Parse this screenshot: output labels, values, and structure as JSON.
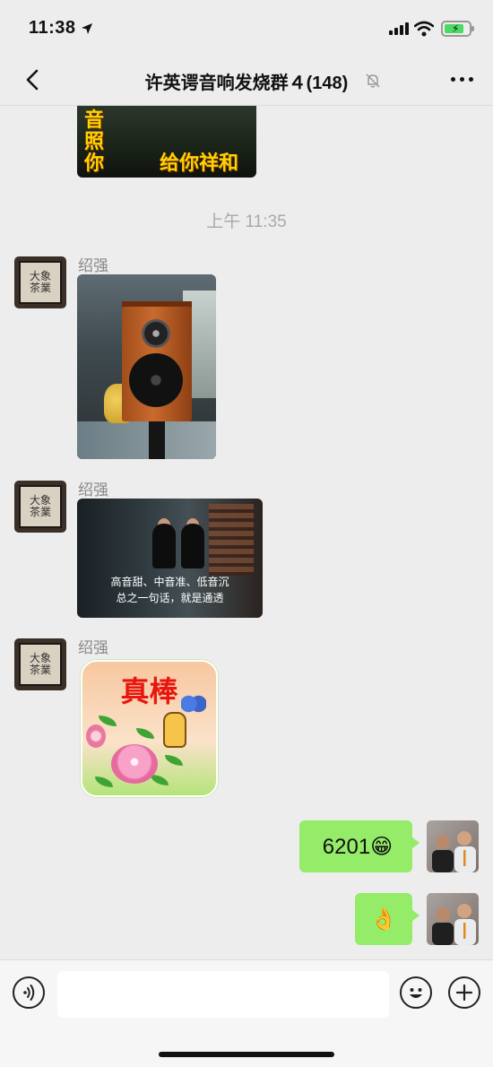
{
  "status_bar": {
    "time": "11:38",
    "battery_level": 0.8
  },
  "nav": {
    "title": "许英谔音响发烧群４(148)"
  },
  "chat": {
    "top_image_text": [
      "音",
      "照",
      "你",
      "给你祥和"
    ],
    "time_separator": "上午 11:35",
    "messages": [
      {
        "sender": "绍强",
        "type": "image"
      },
      {
        "sender": "绍强",
        "type": "image",
        "subtitle_line1": "高音甜、中音准、低音沉",
        "subtitle_line2": "总之一句话，就是通透"
      },
      {
        "sender": "绍强",
        "type": "sticker",
        "sticker_text": "真棒"
      },
      {
        "sender": "self",
        "type": "text",
        "text": "6201😁"
      },
      {
        "sender": "self",
        "type": "emoji",
        "text": "👌"
      }
    ],
    "avatar_text": "大象\n茶業"
  },
  "input": {
    "placeholder": ""
  }
}
